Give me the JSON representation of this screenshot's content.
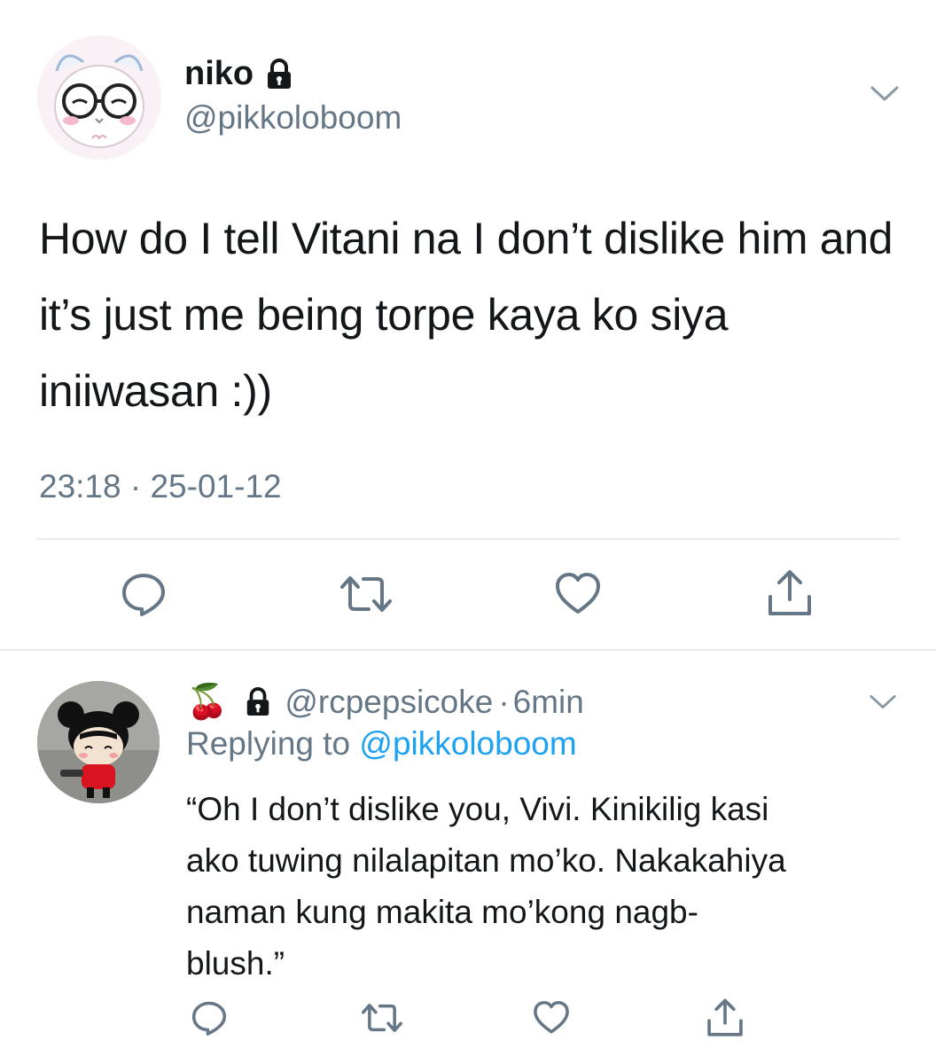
{
  "tweet": {
    "author": {
      "name": "niko",
      "handle": "@pikkoloboom",
      "protected": true,
      "avatar": "cat-with-glasses-avatar"
    },
    "text": "How do I tell Vitani na I don’t dislike him and it’s just me being torpe kaya ko siya iniiwasan :))",
    "time": "23:18",
    "separator": "·",
    "date": "25-01-12",
    "actions": [
      "reply-icon",
      "retweet-icon",
      "like-icon",
      "share-icon"
    ],
    "menu_icon": "chevron-down-icon"
  },
  "reply": {
    "emoji": "🍒",
    "protected": true,
    "handle": "@rcpepsicoke",
    "age": "6min",
    "separator": "·",
    "replying_label": "Replying to",
    "replying_to": "@pikkoloboom",
    "text_lines": [
      "“Oh I don’t dislike you, Vivi. Kinikilig kasi",
      "ako tuwing nilalapitan mo’ko. Nakakahiya",
      "naman kung makita mo’kong nagb-",
      "blush.”"
    ],
    "avatar": "pucca-avatar",
    "actions": [
      "reply-icon",
      "retweet-icon",
      "like-icon",
      "share-icon"
    ],
    "menu_icon": "chevron-down-icon"
  },
  "colors": {
    "text": "#14171a",
    "secondary": "#657786",
    "link": "#1da1f2",
    "divider": "#e6ecf0",
    "icon": "#657786"
  }
}
